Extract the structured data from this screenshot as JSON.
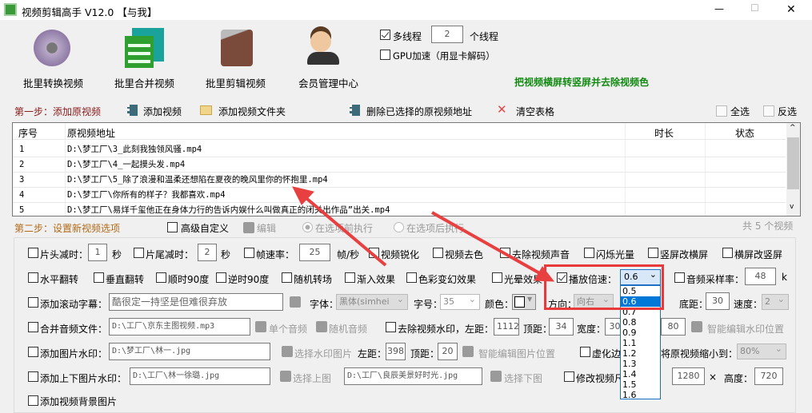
{
  "window": {
    "title": "视频剪辑高手 V12.0  【与我】",
    "minimize": "—",
    "maximize": "☐",
    "close": "✕"
  },
  "toolbar": {
    "items": [
      {
        "label": "批里转换视频"
      },
      {
        "label": "批里合并视频"
      },
      {
        "label": "批里剪辑视频"
      },
      {
        "label": "会员管理中心"
      }
    ],
    "multithread_label": "多线程",
    "threads": "2",
    "threads_unit": "个线程",
    "gpu_label": "GPU加速（用显卡解码）",
    "slogan": "把视频横屏转竖屏并去除视频色"
  },
  "step1": {
    "label": "第一步：添加原视频",
    "add_video": "添加视频",
    "add_folder": "添加视频文件夹",
    "delete_selected": "删除已选择的原视频地址",
    "clear": "清空表格",
    "select_all": "全选",
    "invert": "反选"
  },
  "table": {
    "headers": [
      "序号",
      "原视频地址",
      "时长",
      "状态"
    ],
    "rows": [
      {
        "no": "1",
        "path": "D:\\梦工厂\\3_此刻我独领风骚.mp4"
      },
      {
        "no": "2",
        "path": "D:\\梦工厂\\4_一起摸头发.mp4"
      },
      {
        "no": "3",
        "path": "D:\\梦工厂\\5_除了浪漫和温柔还想陷在夏夜的晚风里你的怀抱里.mp4"
      },
      {
        "no": "4",
        "path": "D:\\梦工厂\\你所有的样子？我都喜欢.mp4"
      },
      {
        "no": "5",
        "path": "D:\\梦工厂\\易烊千玺他正在身体力行的告诉内娱什么叫做真正的闭关出作品”出关.mp4"
      }
    ]
  },
  "step2": {
    "label": "第二步：设置新视频选项",
    "advanced": "高级自定义",
    "edit": "编辑",
    "before": "在选项前执行",
    "after": "在选项后执行",
    "count": "共 5 个视频"
  },
  "opts": {
    "head_cut": "片头减时：",
    "head_val": "1",
    "sec": "秒",
    "tail_cut": "片尾减时：",
    "tail_val": "2",
    "fps": "帧速率：",
    "fps_val": "25",
    "fps_unit": "帧/秒",
    "sharpen": "视频锐化",
    "decolor": "视频去色",
    "mute": "去除视频声音",
    "flash": "闪烁光量",
    "v2h": "竖屏改横屏",
    "h2v": "横屏改竖屏",
    "hflip": "水平翻转",
    "vflip": "垂直翻转",
    "cw90": "顺时90度",
    "ccw90": "逆时90度",
    "random_trans": "随机转场",
    "fadein": "渐入效果",
    "color_fx": "色彩变幻效果",
    "halo": "光晕效果",
    "speed": "播放倍速：",
    "speed_val": "0.6",
    "speed_options": [
      "0.5",
      "0.6",
      "0.7",
      "0.8",
      "0.9",
      "1.1",
      "1.2",
      "1.3",
      "1.4",
      "1.5",
      "1.6"
    ],
    "samplerate": "音频采样率：",
    "samplerate_val": "48",
    "samplerate_unit": "k",
    "scroll_text": "添加滚动字幕：",
    "scroll_text_val": "酷很定一持坚是但难很弃放",
    "font": "字体：",
    "font_val": "黑体(simhei",
    "size": "字号：",
    "size_val": "35",
    "color": "颜色：",
    "direction": "方向：",
    "direction_val": "向右",
    "bottom": "底距：",
    "bottom_val": "30",
    "velocity": "速度：",
    "velocity_val": "2",
    "merge_audio": "合并音频文件：",
    "merge_audio_val": "D:\\工厂\\京东主图视频.mp3",
    "single_audio": "单个音频",
    "random_audio": "随机音频",
    "remove_wm": "去除视频水印，左距：",
    "wm_left": "1112",
    "wm_top_l": "顶距：",
    "wm_top": "34",
    "wm_width_l": "宽度：",
    "wm_width": "300",
    "wm_height": "80",
    "smart_wm": "智能编辑水印位置",
    "img_wm": "添加图片水印：",
    "img_wm_val": "D:\\梦工厂\\林一.jpg",
    "choose_wm": "选择水印图片",
    "left_l": "左距：",
    "img_left": "398",
    "top_l": "顶距：",
    "img_top": "20",
    "smart_img": "智能编辑图片位置",
    "blur": "虚化边",
    "shrink": "将原视频缩小到：",
    "shrink_val": "80%",
    "tb_wm": "添加上下图片水印：",
    "top_img_val": "D:\\工厂\\林一徐璐.jpg",
    "choose_top": "选择上图",
    "bottom_img_val": "D:\\工厂\\良辰美景好时光.jpg",
    "choose_bottom": "选择下图",
    "resize": "修改视频尺",
    "res_w": "1280",
    "times": "×",
    "height_l": "高度：",
    "res_h": "720",
    "bg_img": "添加视频背景图片"
  }
}
